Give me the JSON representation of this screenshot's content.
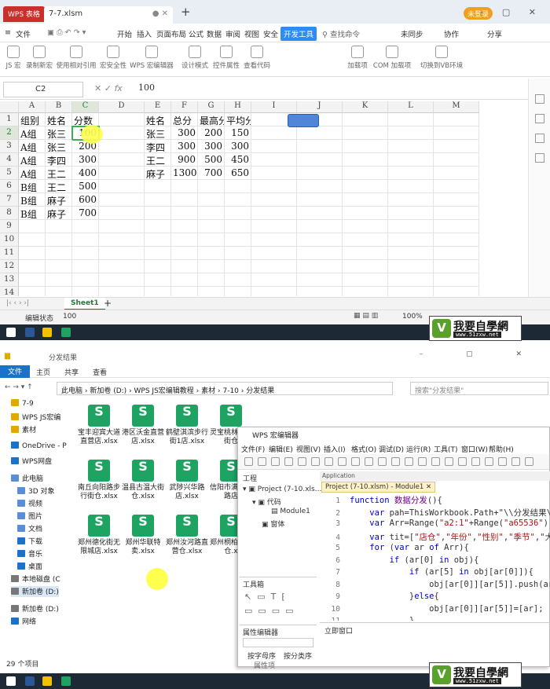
{
  "wps": {
    "app_tab": "WPS 表格",
    "file_tab": "7-7.xlsm",
    "login_btn": "未登录",
    "menu": [
      "文件",
      "开始",
      "插入",
      "页面布局",
      "公式",
      "数据",
      "审阅",
      "视图",
      "安全",
      "开发工具",
      "查找命令"
    ],
    "menu_right": [
      "未同步",
      "协作",
      "分享"
    ],
    "ribbon": [
      "JS 宏",
      "录制新宏",
      "使用相对引用",
      "宏安全性",
      "WPS 宏编辑器",
      "设计模式",
      "控件属性",
      "查看代码",
      "加载项",
      "COM 加载项",
      "切换到VB环境"
    ],
    "namebox": "C2",
    "formula_value": "100",
    "columns": [
      "A",
      "B",
      "C",
      "D",
      "E",
      "F",
      "G",
      "H",
      "I",
      "J",
      "K",
      "L",
      "M"
    ],
    "rows": [
      "1",
      "2",
      "3",
      "4",
      "5",
      "6",
      "7",
      "8",
      "9",
      "10",
      "11",
      "12",
      "13",
      "14",
      "15"
    ],
    "table1": [
      [
        "组别",
        "姓名",
        "分数"
      ],
      [
        "A组",
        "张三",
        "100"
      ],
      [
        "A组",
        "张三",
        "200"
      ],
      [
        "A组",
        "李四",
        "300"
      ],
      [
        "A组",
        "王二",
        "400"
      ],
      [
        "B组",
        "王二",
        "500"
      ],
      [
        "B组",
        "麻子",
        "600"
      ],
      [
        "B组",
        "麻子",
        "700"
      ]
    ],
    "table2": [
      [
        "姓名",
        "总分",
        "最高分",
        "平均分"
      ],
      [
        "张三",
        "300",
        "200",
        "150"
      ],
      [
        "李四",
        "300",
        "300",
        "300"
      ],
      [
        "王二",
        "900",
        "500",
        "450"
      ],
      [
        "麻子",
        "1300",
        "700",
        "650"
      ]
    ],
    "sheet_tab": "Sheet1",
    "status_mode": "编辑状态",
    "status_value": "100",
    "zoom": "100%"
  },
  "explorer": {
    "title": "分发结果",
    "ribbon_tabs": [
      "文件",
      "主页",
      "共享",
      "查看"
    ],
    "breadcrumb": [
      "此电脑",
      "新加卷 (D:)",
      "WPS JS宏编辑教程",
      "素材",
      "7-10",
      "分发结果"
    ],
    "search_placeholder": "搜索\"分发结果\"",
    "nav": [
      "7-9",
      "WPS JS宏编",
      "素材",
      "OneDrive - P",
      "WPS网盘",
      "此电脑",
      "3D 对象",
      "视频",
      "图片",
      "文档",
      "下载",
      "音乐",
      "桌面",
      "本地磁盘 (C",
      "新加卷 (D:)",
      "新加卷 (D:)",
      "网络"
    ],
    "files": [
      "宝丰迎宾大道直营店.xlsx",
      "港区沃金直营店.xlsx",
      "鹤壁淇滨步行街1店.xlsx",
      "灵宝桃林下金街仓",
      "南丘向阳路步行街仓.xlsx",
      "温县古温大街仓.xlsx",
      "武陟兴华路店.xlsx",
      "信阳市满跃进路店",
      "郑州德化街无限城店.xlsx",
      "郑州华联特卖.xlsx",
      "郑州汝河路直营仓.xlsx",
      "郑州桐柏直营仓.x"
    ],
    "count": "29 个项目"
  },
  "macro": {
    "title": "WPS 宏编辑器",
    "menu": [
      "文件(F)",
      "编辑(E)",
      "视图(V)",
      "插入(I)",
      "格式(O)",
      "调试(D)",
      "运行(R)",
      "工具(T)",
      "窗口(W)",
      "帮助(H)"
    ],
    "project_title": "工程",
    "project_root": "Project (7-10.xls...",
    "code_folder": "代码",
    "module": "Module1",
    "forms": "窗体",
    "toolbox": "工具箱",
    "prop_editor": "属性编辑器",
    "prop_tabs": [
      "按字母序",
      "按分类序"
    ],
    "prop_col": "属性项",
    "app_label": "Application",
    "module_tab": "Project (7-10.xlsm) - Module1",
    "immediate": "立即窗口",
    "lines": [
      {
        "n": "1",
        "t": "function 数据分发(){"
      },
      {
        "n": "2",
        "t": "    var pah=ThisWorkbook.Path+\"\\\\分发结果\\\\"
      },
      {
        "n": "3",
        "t": "    var Arr=Range(\"a2:1\"+Range(\"a65536\").E"
      },
      {
        "n": "4",
        "t": "    var tit=[\"店仓\",\"年份\",\"性别\",\"季节\",\"大"
      },
      {
        "n": "5",
        "t": "    for (var ar of Arr){"
      },
      {
        "n": "6",
        "t": "        if (ar[0] in obj){"
      },
      {
        "n": "7",
        "t": "            if (ar[5] in obj[ar[0]]){"
      },
      {
        "n": "8",
        "t": "                obj[ar[0]][ar[5]].push(ar)"
      },
      {
        "n": "9",
        "t": "            }else{"
      },
      {
        "n": "10",
        "t": "                obj[ar[0]][ar[5]]=[ar];"
      },
      {
        "n": "11",
        "t": "            }"
      },
      {
        "n": "12",
        "t": "        }else{"
      },
      {
        "n": "13",
        "t": "            obj[ar[0]]={[ar[5]]:[ar]};"
      }
    ]
  },
  "logo": {
    "cn": "我要自學網",
    "url": "www.51zxw.net"
  }
}
